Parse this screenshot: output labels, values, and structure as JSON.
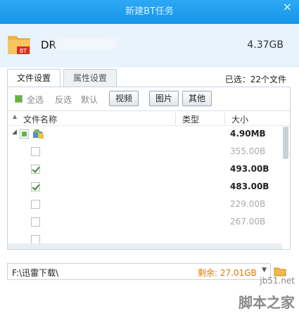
{
  "window": {
    "title": "新建BT任务",
    "close_glyph": "×"
  },
  "task": {
    "name_visible": "DR",
    "total_size": "4.37GB",
    "badge": "BT"
  },
  "tabs": [
    {
      "label": "文件设置",
      "active": true
    },
    {
      "label": "属性设置",
      "active": false
    }
  ],
  "selected_count": "已选：22个文件",
  "toolbar": {
    "select_all": "全选",
    "invert": "反选",
    "default": "默认",
    "filters": [
      "视频",
      "图片",
      "其他"
    ]
  },
  "columns": {
    "name": "文件名称",
    "type": "类型",
    "size": "大小"
  },
  "rows": [
    {
      "level": 0,
      "state": "partial",
      "size": "4.90MB",
      "style": "bold",
      "icon": "folder-tree-icon"
    },
    {
      "level": 1,
      "state": "off",
      "size": "355.00B",
      "style": "dim"
    },
    {
      "level": 1,
      "state": "on",
      "size": "493.00B",
      "style": "bold"
    },
    {
      "level": 1,
      "state": "on",
      "size": "483.00B",
      "style": "bold"
    },
    {
      "level": 1,
      "state": "off",
      "size": "229.00B",
      "style": "dim"
    },
    {
      "level": 1,
      "state": "off",
      "size": "267.00B",
      "style": "dim"
    },
    {
      "level": 1,
      "state": "off",
      "size": "",
      "style": "dim"
    }
  ],
  "save_path": {
    "path": "F:\\迅雷下载\\",
    "free": "剩余: 27.01GB"
  },
  "colors": {
    "titlebar": "#1e9eee",
    "accent_orange": "#e07800",
    "check_green": "#5fb83e"
  },
  "watermark": {
    "site": "jb51.net",
    "name": "脚本之家"
  }
}
